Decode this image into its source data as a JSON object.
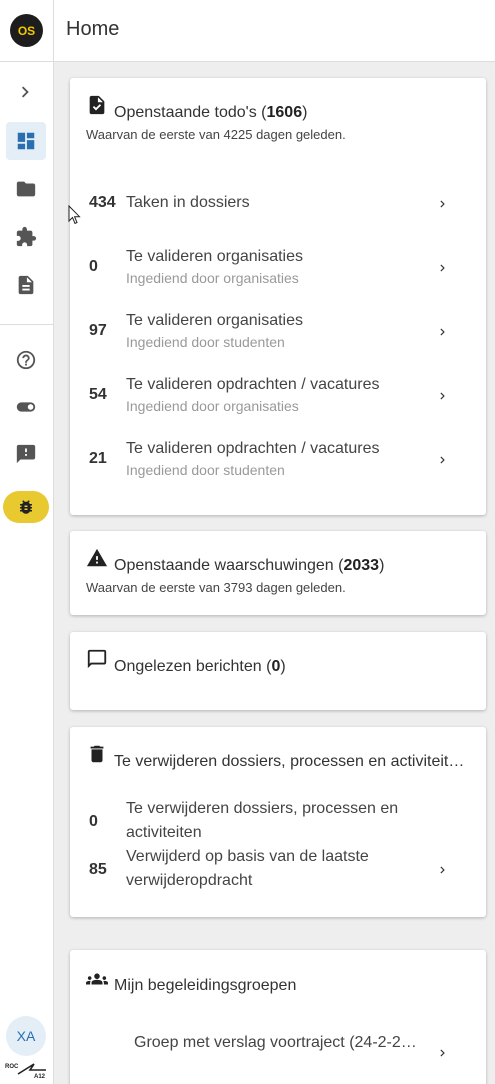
{
  "app": {
    "logo_text": "OS",
    "page_title": "Home",
    "accent": "#2a6fb0",
    "brand_yellow": "#f5c800"
  },
  "sidebar": {
    "items": [
      {
        "icon": "chevron-right-icon"
      },
      {
        "icon": "dashboard-icon",
        "active": true
      },
      {
        "icon": "folder-icon"
      },
      {
        "icon": "puzzle-icon"
      },
      {
        "icon": "document-icon"
      },
      {
        "icon": "help-icon"
      },
      {
        "icon": "toggle-icon"
      },
      {
        "icon": "feedback-icon"
      },
      {
        "icon": "bug-icon"
      }
    ],
    "avatar_initials": "XA",
    "footer_logo_text": "ROC A12"
  },
  "todos": {
    "title_prefix": "Openstaande todo's (",
    "count": "1606",
    "title_suffix": ")",
    "subtitle": "Waarvan de eerste van 4225 dagen geleden.",
    "rows": [
      {
        "count": "434",
        "label": "Taken in dossiers",
        "sublabel": ""
      },
      {
        "count": "0",
        "label": "Te valideren organisaties",
        "sublabel": "Ingediend door organisaties"
      },
      {
        "count": "97",
        "label": "Te valideren organisaties",
        "sublabel": "Ingediend door studenten"
      },
      {
        "count": "54",
        "label": "Te valideren opdrachten / vacatures",
        "sublabel": "Ingediend door organisaties"
      },
      {
        "count": "21",
        "label": "Te valideren opdrachten / vacatures",
        "sublabel": "Ingediend door studenten"
      }
    ]
  },
  "warnings": {
    "title_prefix": "Openstaande waarschuwingen (",
    "count": "2033",
    "title_suffix": ")",
    "subtitle": "Waarvan de eerste van 3793 dagen geleden."
  },
  "messages": {
    "title_prefix": "Ongelezen berichten (",
    "count": "0",
    "title_suffix": ")"
  },
  "deletions": {
    "title": "Te verwijderen dossiers, processen en activiteit…",
    "rows": [
      {
        "count": "0",
        "label_line1": "Te verwijderen dossiers, processen en",
        "label_line2": "activiteiten"
      },
      {
        "count": "85",
        "label_line1": "Verwijderd op basis van de laatste",
        "label_line2": "verwijderopdracht"
      }
    ]
  },
  "groups": {
    "title": "Mijn begeleidingsgroepen",
    "rows": [
      {
        "label": "Groep met verslag voortraject (24-2-20…"
      }
    ]
  }
}
